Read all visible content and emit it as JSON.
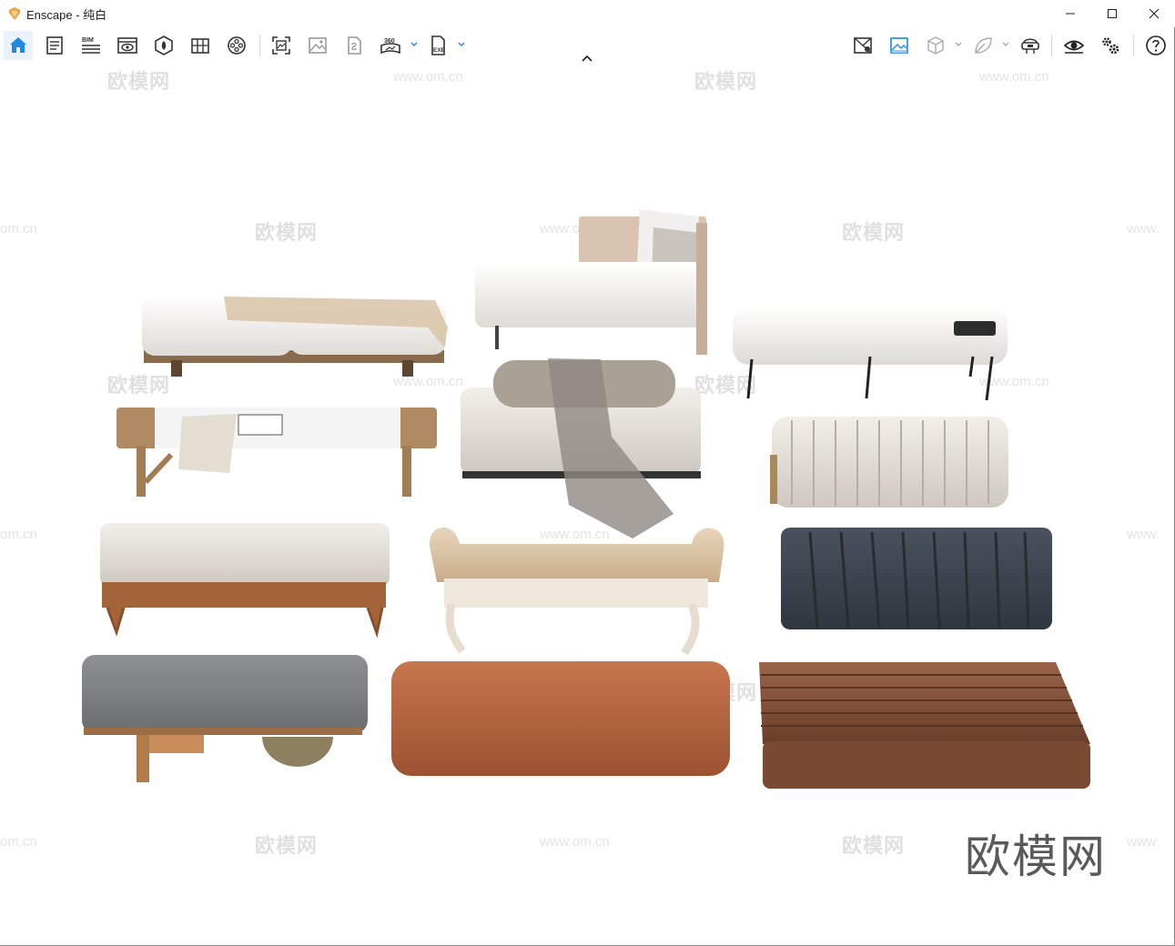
{
  "window": {
    "title": "Enscape - 纯白",
    "brand_color": "#f0a030"
  },
  "toolbar": {
    "left_tools": [
      "home-icon",
      "notes-icon",
      "bim-icon",
      "view-eye-icon",
      "asset-library-icon",
      "material-icon",
      "video-reel-icon",
      "screenshot-icon",
      "image-icon",
      "batch-render-icon",
      "panorama-360-icon",
      "export-exe-icon"
    ],
    "bim_label": "BIM",
    "panorama_label": "360",
    "exe_label": "EXE",
    "right_tools": [
      "map-pin-icon",
      "background-image-icon",
      "cube-view-icon",
      "leaf-icon",
      "vr-headset-icon",
      "visibility-icon",
      "settings-icon",
      "help-icon"
    ]
  },
  "watermarks": {
    "logo_text": "欧模网",
    "url_text": "www.om.cn",
    "url_partial_left": "om.cn",
    "url_partial_right": "www.",
    "brand_text": "欧模网"
  }
}
